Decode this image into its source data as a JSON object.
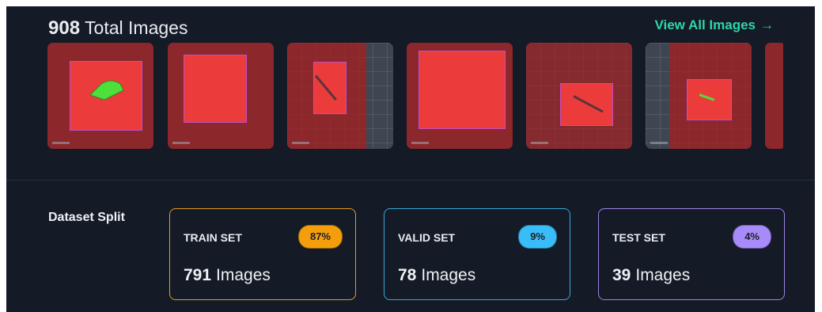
{
  "header": {
    "total_count": "908",
    "total_label": "Total Images",
    "view_all_label": "View All Images",
    "view_all_arrow": "→"
  },
  "thumbnails": [
    {
      "name": "thumbnail-1",
      "icon": "image-thumbnail"
    },
    {
      "name": "thumbnail-2",
      "icon": "image-thumbnail"
    },
    {
      "name": "thumbnail-3",
      "icon": "image-thumbnail"
    },
    {
      "name": "thumbnail-4",
      "icon": "image-thumbnail"
    },
    {
      "name": "thumbnail-5",
      "icon": "image-thumbnail"
    },
    {
      "name": "thumbnail-6",
      "icon": "image-thumbnail"
    },
    {
      "name": "thumbnail-7",
      "icon": "image-thumbnail"
    }
  ],
  "dataset_split": {
    "label": "Dataset Split",
    "train": {
      "title": "TRAIN SET",
      "percent": "87%",
      "count": "791",
      "unit": "Images",
      "color": "#f39c12"
    },
    "valid": {
      "title": "VALID SET",
      "percent": "9%",
      "count": "78",
      "unit": "Images",
      "color": "#38bdf8"
    },
    "test": {
      "title": "TEST SET",
      "percent": "4%",
      "count": "39",
      "unit": "Images",
      "color": "#a78bfa"
    }
  },
  "colors": {
    "background": "#141a26",
    "accent": "#2fd6a9",
    "annotation_fill": "#ec3b3b",
    "annotation_border": "#c050c8"
  }
}
